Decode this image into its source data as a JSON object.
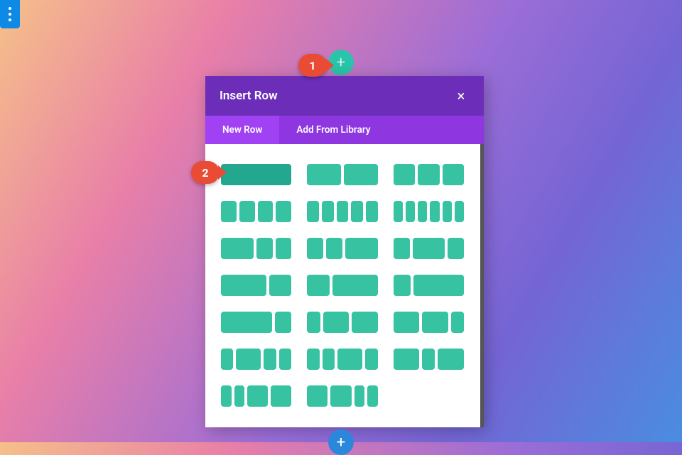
{
  "floatingMenu": {
    "icon": "more-vertical"
  },
  "addSectionTop": {
    "label": "+"
  },
  "addSectionBottom": {
    "label": "+"
  },
  "modal": {
    "title": "Insert Row",
    "close": "×",
    "tabs": [
      {
        "label": "New Row",
        "active": true
      },
      {
        "label": "Add From Library",
        "active": false
      }
    ],
    "layouts": [
      {
        "cols": [
          1
        ],
        "hovered": true
      },
      {
        "cols": [
          1,
          1
        ]
      },
      {
        "cols": [
          1,
          1,
          1
        ]
      },
      {
        "cols": [
          1,
          1,
          1,
          1
        ]
      },
      {
        "cols": [
          1,
          1,
          1,
          1,
          1
        ]
      },
      {
        "cols": [
          1,
          1,
          1,
          1,
          1,
          1
        ]
      },
      {
        "cols": [
          2,
          1,
          1
        ]
      },
      {
        "cols": [
          1,
          1,
          2
        ]
      },
      {
        "cols": [
          1,
          2,
          1
        ]
      },
      {
        "cols": [
          2,
          1
        ]
      },
      {
        "cols": [
          1,
          2
        ]
      },
      {
        "cols": [
          1,
          3
        ]
      },
      {
        "cols": [
          3,
          1
        ]
      },
      {
        "cols": [
          1,
          2,
          2
        ]
      },
      {
        "cols": [
          2,
          2,
          1
        ]
      },
      {
        "cols": [
          1,
          2,
          1,
          1
        ]
      },
      {
        "cols": [
          1,
          1,
          2,
          1
        ]
      },
      {
        "cols": [
          2,
          1,
          2
        ]
      },
      {
        "cols": [
          1,
          1,
          2,
          2
        ]
      },
      {
        "cols": [
          2,
          2,
          1,
          1
        ]
      }
    ]
  },
  "markers": {
    "m1": "1",
    "m2": "2"
  }
}
